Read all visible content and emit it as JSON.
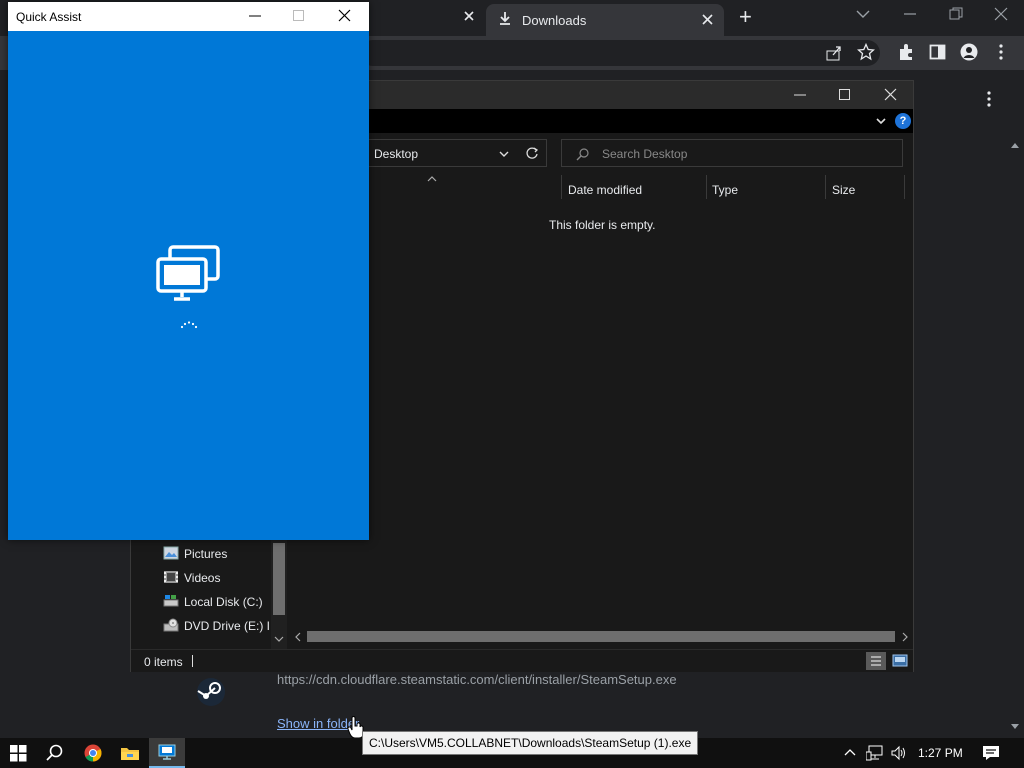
{
  "browser": {
    "tab_title": "Downloads",
    "new_tab": "+",
    "colors": {
      "frame": "#202124",
      "toolbar": "#35363a"
    }
  },
  "download": {
    "url": "https://cdn.cloudflare.steamstatic.com/client/installer/SteamSetup.exe",
    "show_in_folder": "Show in folder",
    "tooltip": "C:\\Users\\VM5.COLLABNET\\Downloads\\SteamSetup (1).exe"
  },
  "explorer": {
    "address": "Desktop",
    "search_placeholder": "Search Desktop",
    "columns": [
      "Date modified",
      "Type",
      "Size"
    ],
    "empty_text": "This folder is empty.",
    "nav_items": [
      {
        "label": "Pictures",
        "icon": "pictures-folder-icon"
      },
      {
        "label": "Videos",
        "icon": "videos-folder-icon"
      },
      {
        "label": "Local Disk (C:)",
        "icon": "local-disk-icon"
      },
      {
        "label": "DVD Drive (E:) In",
        "icon": "dvd-drive-icon"
      }
    ],
    "status": "0 items",
    "help": "?"
  },
  "quick_assist": {
    "title": "Quick Assist",
    "accent": "#0078d7"
  },
  "taskbar": {
    "time": "1:27 PM"
  }
}
